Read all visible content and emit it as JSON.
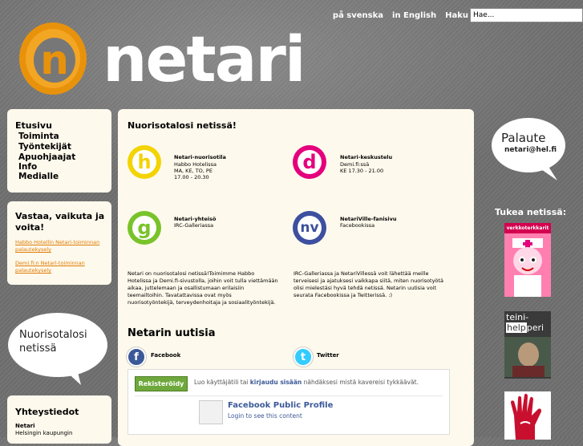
{
  "header": {
    "lang_sv": "på svenska",
    "lang_en": "in English",
    "search_label": "Haku",
    "search_value": "Hae...",
    "logo_text": "netari",
    "logo_letter": "n"
  },
  "nav": {
    "title": "Etusivu",
    "items": [
      "Toiminta",
      "Työntekijät",
      "Apuohjaajat",
      "Info",
      "Medialle"
    ]
  },
  "vastaa": {
    "heading": "Vastaa, vaikuta ja voita!",
    "links": [
      "Habbo Hotellin Netari-toiminnan palautekysely",
      "Demi.fi:n Netari-toiminnan palautekysely"
    ]
  },
  "bubble_left": {
    "line1": "Nuorisotalosi",
    "line2": "netissä"
  },
  "yhteystiedot": {
    "title": "Yhteystiedot",
    "name": "Netari",
    "org": "Helsingin kaupungin"
  },
  "main": {
    "title": "Nuorisotalosi netissä!",
    "services": [
      {
        "letter": "h",
        "color": "#f3d300",
        "name": "Netari-nuorisotila",
        "lines": [
          "Habbo Hotelissa",
          "MA, KE, TO, PE",
          "17.00 - 20.30"
        ]
      },
      {
        "letter": "d",
        "color": "#e4007c",
        "name": "Netari-keskustelu",
        "lines": [
          "Demi.fi:ssä",
          "KE 17.30 - 21.00"
        ]
      },
      {
        "letter": "g",
        "color": "#79c32a",
        "name": "Netari-yhteisö",
        "lines": [
          "IRC-Galleriassa"
        ]
      },
      {
        "letter": "nv",
        "color": "#3d4f9f",
        "name": "NetariVille-fanisivu",
        "lines": [
          "Facebookissa"
        ]
      }
    ],
    "para_left": "Netari on nuorisotalosi netissä!Toimimme Habbo Hotelissa ja Demi.fi-sivustolla, joihin voit tulla viettämään aikaa, juttelemaan ja osallistumaan erilaisiin teemailtoihin. Tavatattavissa ovat myös nuorisotyöntekijä, terveydenhoitaja ja sosiaalityöntekijä.",
    "para_right": "IRC-Galleriassa ja NetariVillessä voit lähettää meille terveisesi ja ajatuksesi vaikkapa siitä, miten nuorisotyötä olisi mielestäsi hyvä tehdä netissä. Netarin uutisia voit seurata Facebookissa ja Twitterissä. :)",
    "news_title": "Netarin uutisia",
    "facebook_label": "Facebook",
    "twitter_label": "Twitter",
    "facebook_letter": "f",
    "twitter_letter": "t"
  },
  "fb_widget": {
    "register_button": "Rekisteröidy",
    "text_before": "Luo käyttäjätili tai ",
    "login_link": "kirjaudu sisään",
    "text_after": " nähdäksesi mistä kavereisi tykkäävät.",
    "profile_name": "Facebook Public Profile",
    "profile_sub": "Login to see this content"
  },
  "right": {
    "palaute_title": "Palaute",
    "palaute_email": "netari@hel.fi",
    "tukea_title": "Tukea netissä:",
    "ad1_text": "verkkoterkkarit",
    "ad2_text1": "teini-",
    "ad2_text2": "help",
    "ad2_text3": "peri"
  },
  "colors": {
    "accent_orange": "#e8920c",
    "link_orange": "#e07b00",
    "panel_bg": "#fdf9ec"
  }
}
